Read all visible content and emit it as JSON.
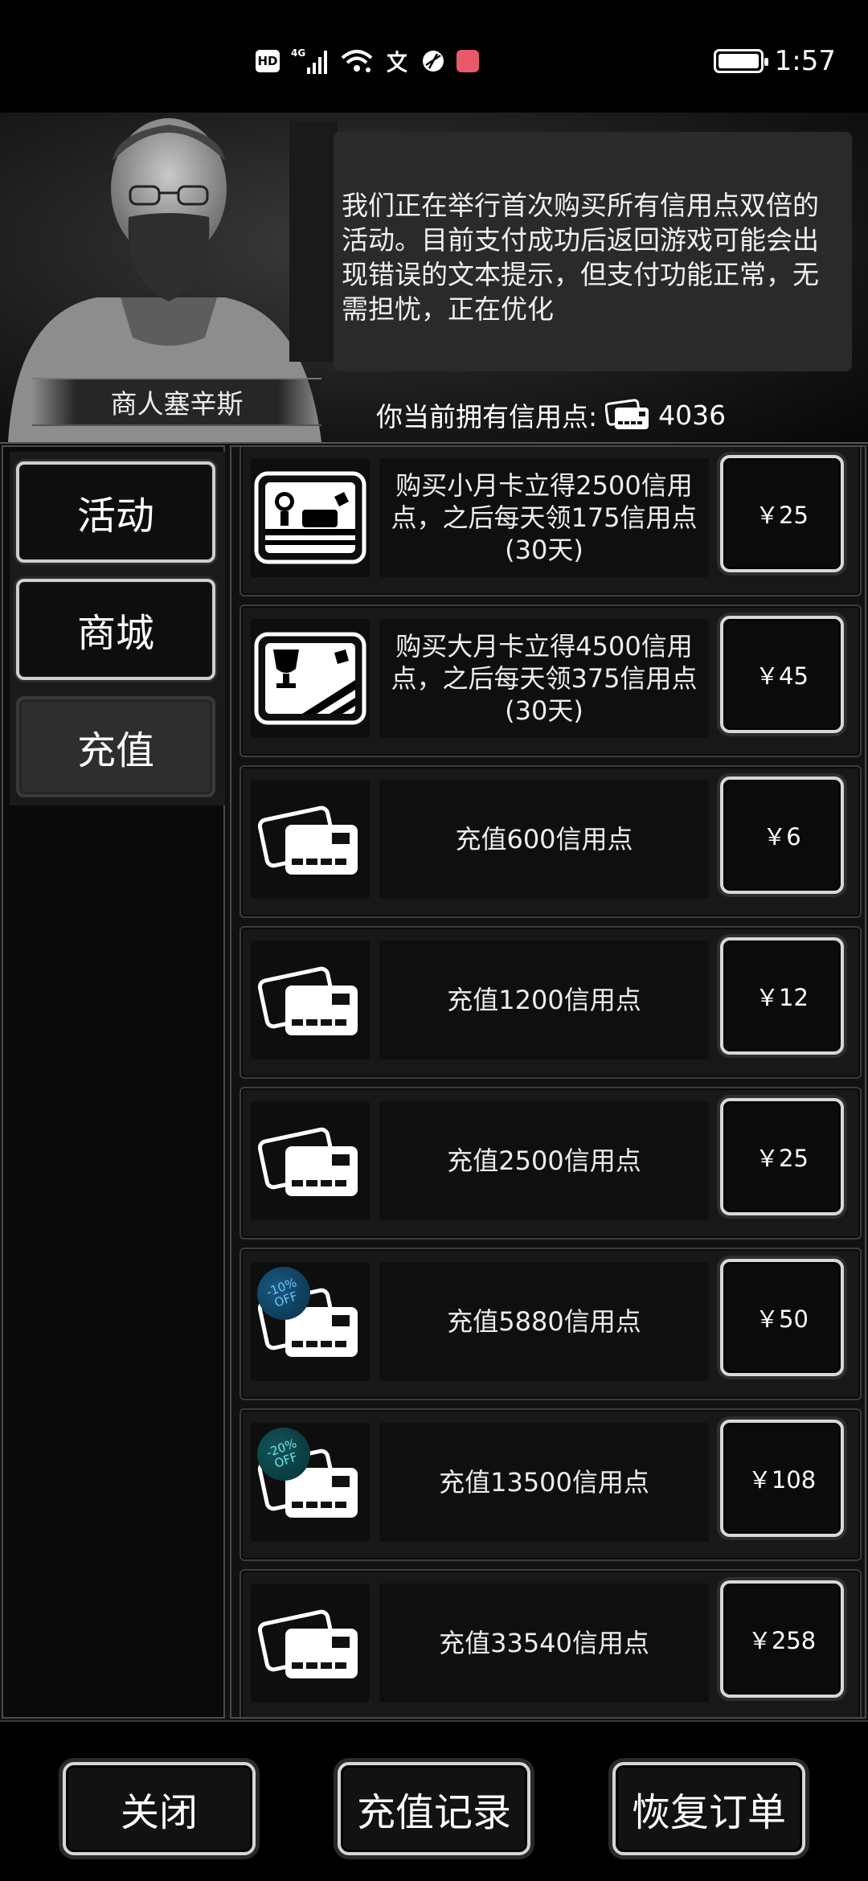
{
  "status_bar": {
    "hd": "HD",
    "network": "4G",
    "time": "1:57",
    "icons": [
      "hd-icon",
      "signal-icon",
      "wifi-icon",
      "wen-icon",
      "browser-icon",
      "book-app-icon",
      "battery-icon"
    ]
  },
  "npc": {
    "name": "商人塞辛斯",
    "dialog": "我们正在举行首次购买所有信用点双倍的活动。目前支付成功后返回游戏可能会出现错误的文本提示，但支付功能正常，无需担忧，正在优化"
  },
  "credits": {
    "label": "你当前拥有信用点:",
    "value": "4036"
  },
  "tabs": [
    {
      "label": "活动",
      "active": false
    },
    {
      "label": "商城",
      "active": false
    },
    {
      "label": "充值",
      "active": true
    }
  ],
  "items": [
    {
      "icon": "small-month-card-icon",
      "text": "购买小月卡立得2500信用点，之后每天领175信用点(30天)",
      "price": "￥25"
    },
    {
      "icon": "big-month-card-icon",
      "text": "购买大月卡立得4500信用点，之后每天领375信用点(30天)",
      "price": "￥45"
    },
    {
      "icon": "credit-cards-icon",
      "text": "充值600信用点",
      "price": "￥6"
    },
    {
      "icon": "credit-cards-icon",
      "text": "充值1200信用点",
      "price": "￥12"
    },
    {
      "icon": "credit-cards-icon",
      "text": "充值2500信用点",
      "price": "￥25"
    },
    {
      "icon": "credit-cards-icon",
      "text": "充值5880信用点",
      "price": "￥50",
      "badge": "-10% OFF"
    },
    {
      "icon": "credit-cards-icon",
      "text": "充值13500信用点",
      "price": "￥108",
      "badge": "-20% OFF"
    },
    {
      "icon": "credit-cards-icon",
      "text": "充值33540信用点",
      "price": "￥258"
    }
  ],
  "footer": {
    "close": "关闭",
    "history": "充值记录",
    "restore": "恢复订单"
  }
}
